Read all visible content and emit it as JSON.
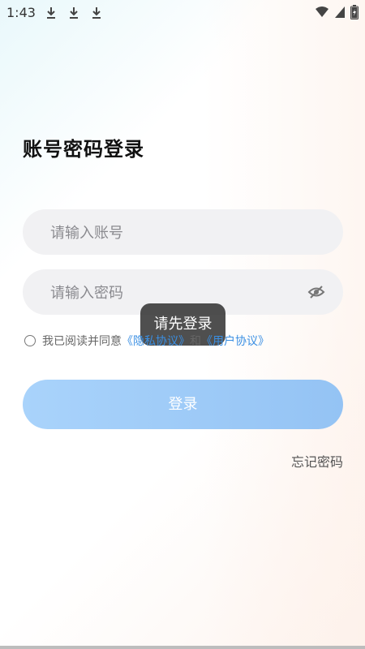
{
  "status_bar": {
    "time": "1:43",
    "download_icons": [
      "download-icon",
      "download-icon",
      "download-icon"
    ],
    "wifi_icon": "wifi-icon",
    "signal_icon": "signal-icon",
    "battery_icon": "battery-charging-icon"
  },
  "login": {
    "title": "账号密码登录",
    "account_placeholder": "请输入账号",
    "password_placeholder": "请输入密码",
    "toggle_password_icon": "eye-off-icon",
    "agreement": {
      "prefix": "我已阅读并同意",
      "privacy_link": "《隐私协议》",
      "and": "和",
      "user_link": "《用户协议》"
    },
    "login_button": "登录",
    "forgot_password": "忘记密码"
  },
  "toast": {
    "text": "请先登录"
  },
  "colors": {
    "button_start": "#a9d3fb",
    "button_end": "#94c3f4",
    "link": "#3a8fe3",
    "toast_bg": "#282828"
  }
}
